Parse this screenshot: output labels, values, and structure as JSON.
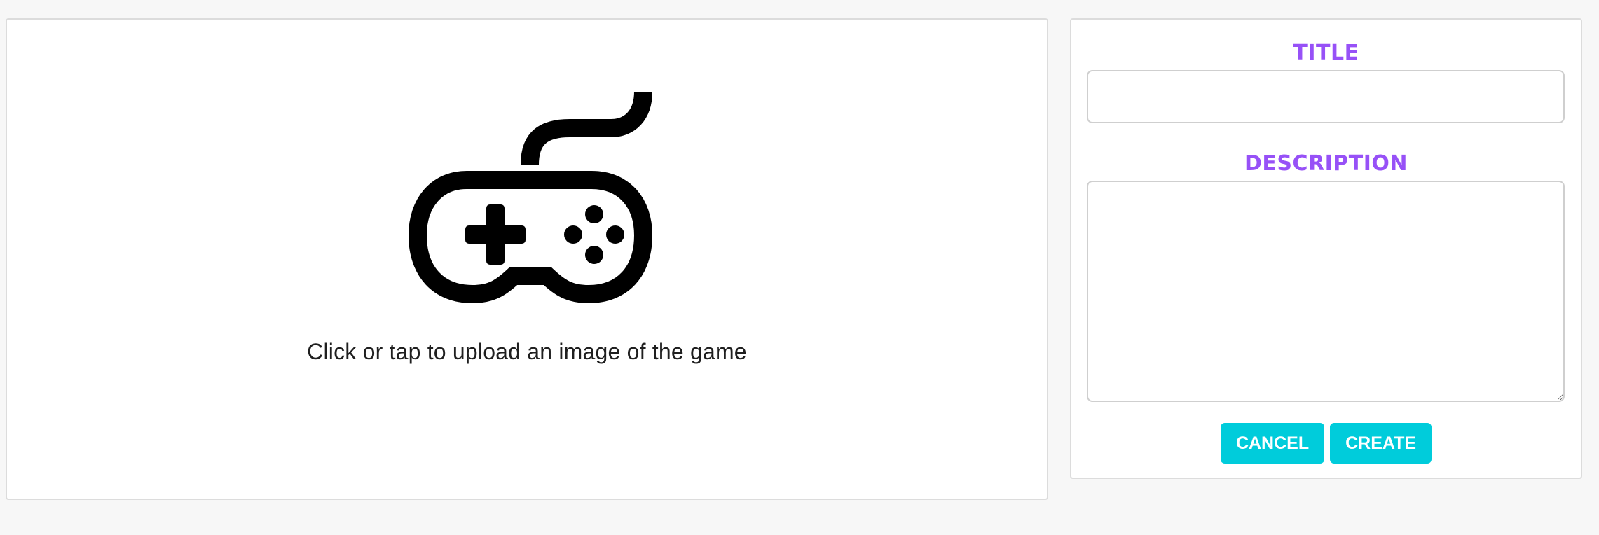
{
  "upload": {
    "icon": "game-controller-icon",
    "prompt": "Click or tap to upload an image of the game"
  },
  "form": {
    "title_label": "TITLE",
    "title_value": "",
    "description_label": "DESCRIPTION",
    "description_value": "",
    "cancel_label": "CANCEL",
    "create_label": "CREATE"
  },
  "colors": {
    "accent_label": "#9751f7",
    "button": "#00ccdb",
    "background": "#f7f7f7"
  }
}
